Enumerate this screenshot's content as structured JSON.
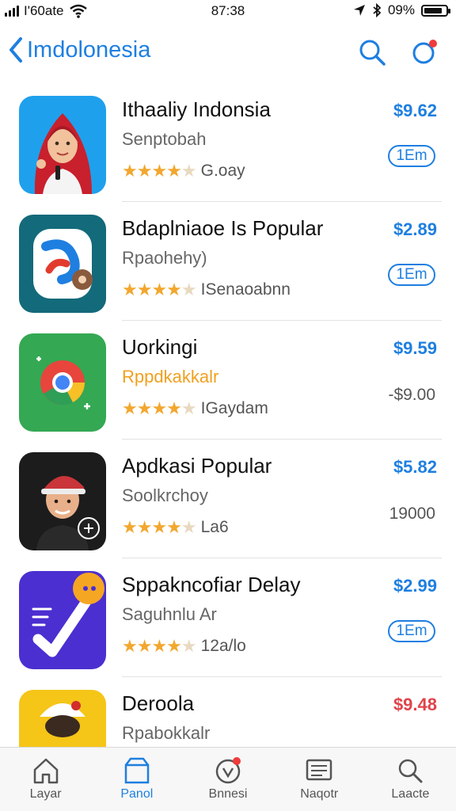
{
  "status_bar": {
    "carrier": "I'60ate",
    "time": "87:38",
    "battery": "09%"
  },
  "header": {
    "back_label": "Imdolonesia"
  },
  "apps": [
    {
      "title": "Ithaaliy Indonsia",
      "subtitle": "Senptobah",
      "rating_label": "G.oay",
      "price": "$9.62",
      "action": "1Em",
      "action_style": "button"
    },
    {
      "title": "Bdaplniaoe Is Popular",
      "subtitle": "Rpaohehy)",
      "rating_label": "ISenaoabnn",
      "price": "$2.89",
      "action": "1Em",
      "action_style": "button"
    },
    {
      "title": "Uorkingi",
      "subtitle": "Rppdkakkalr",
      "rating_label": "IGaydam",
      "price": "$9.59",
      "action": "-$9.00",
      "action_style": "plain"
    },
    {
      "title": "Apdkasi Popular",
      "subtitle": "Soolkrchoy",
      "rating_label": "La6",
      "price": "$5.82",
      "action": "19000",
      "action_style": "plain"
    },
    {
      "title": "Sppakncofiar Delay",
      "subtitle": "Saguhnlu Ar",
      "rating_label": "12a/lo",
      "price": "$2.99",
      "action": "1Em",
      "action_style": "button"
    },
    {
      "title": "Deroola",
      "subtitle": "Rpabokkalr",
      "rating_label": "",
      "price": "$9.48",
      "action": "",
      "action_style": "none"
    }
  ],
  "tabs": [
    {
      "label": "Layar",
      "icon": "home-icon"
    },
    {
      "label": "Panol",
      "icon": "store-icon"
    },
    {
      "label": "Bnnesi",
      "icon": "compass-icon"
    },
    {
      "label": "Naqotr",
      "icon": "list-icon"
    },
    {
      "label": "Laacte",
      "icon": "search-icon"
    }
  ],
  "colors": {
    "accent": "#1e7fe0",
    "star": "#f2a72e",
    "badge": "#ef3b3b",
    "last_price": "#e0434a",
    "subtitle_highlight": "#f0a020"
  }
}
